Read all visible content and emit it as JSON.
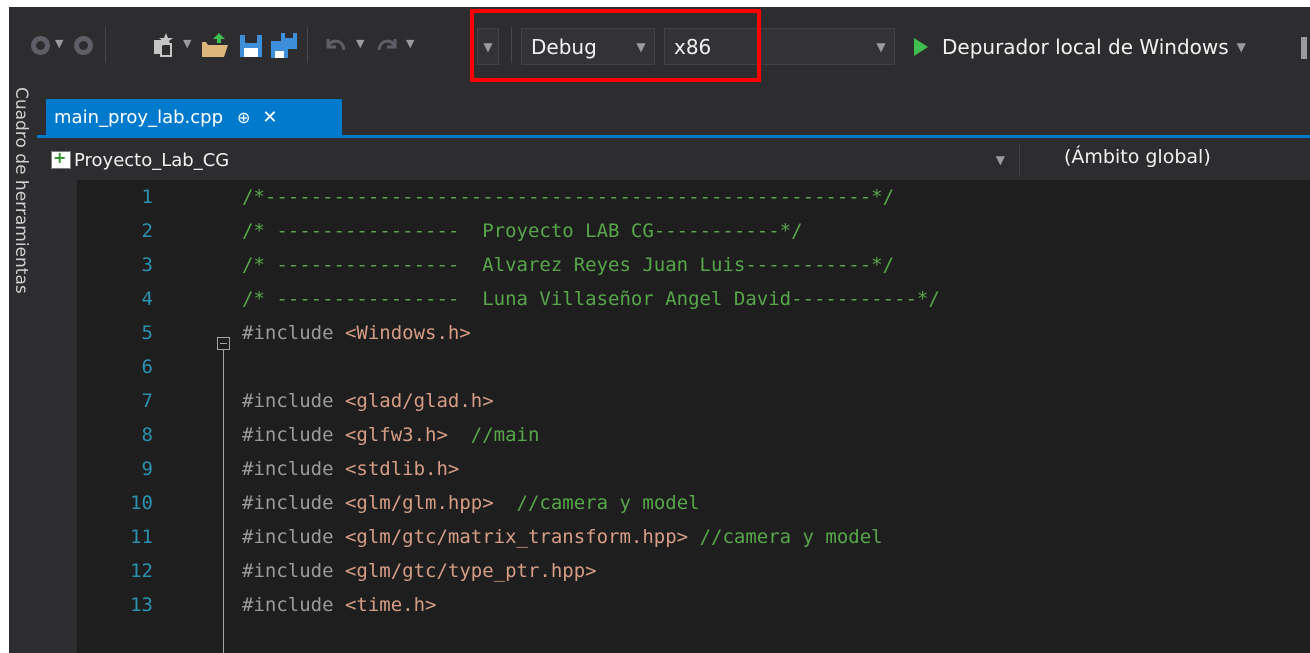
{
  "toolbar": {
    "configuration": "Debug",
    "platform": "x86",
    "run_label": "Depurador local de Windows",
    "icons": [
      "navigate-back-icon",
      "navigate-forward-icon",
      "new-project-icon",
      "open-folder-icon",
      "save-icon",
      "save-all-icon",
      "undo-icon",
      "redo-icon"
    ]
  },
  "side_panel": {
    "label": "Cuadro de herramientas"
  },
  "tabs": [
    {
      "label": "main_proy_lab.cpp",
      "pin": "⊕",
      "close": "✕",
      "active": true
    }
  ],
  "navbar": {
    "project": "Proyecto_Lab_CG",
    "scope": "(Ámbito global)"
  },
  "code": [
    {
      "n": "1",
      "parts": [
        {
          "t": "/*-----------------------------------------------------*/",
          "c": "comment"
        }
      ]
    },
    {
      "n": "2",
      "parts": [
        {
          "t": "/* ----------------  Proyecto LAB CG-----------*/",
          "c": "comment"
        }
      ]
    },
    {
      "n": "3",
      "parts": [
        {
          "t": "/* ----------------  Alvarez Reyes Juan Luis-----------*/",
          "c": "comment"
        }
      ]
    },
    {
      "n": "4",
      "parts": [
        {
          "t": "/* ----------------  Luna Villaseñor Angel David-----------*/",
          "c": "comment"
        }
      ]
    },
    {
      "n": "5",
      "parts": [
        {
          "t": "#include ",
          "c": "kw"
        },
        {
          "t": "<Windows.h>",
          "c": "inc"
        }
      ]
    },
    {
      "n": "6",
      "parts": []
    },
    {
      "n": "7",
      "parts": [
        {
          "t": "#include ",
          "c": "kw"
        },
        {
          "t": "<glad/glad.h>",
          "c": "inc"
        }
      ]
    },
    {
      "n": "8",
      "parts": [
        {
          "t": "#include ",
          "c": "kw"
        },
        {
          "t": "<glfw3.h>",
          "c": "inc"
        },
        {
          "t": "  //main",
          "c": "comment"
        }
      ]
    },
    {
      "n": "9",
      "parts": [
        {
          "t": "#include ",
          "c": "kw"
        },
        {
          "t": "<stdlib.h>",
          "c": "inc"
        }
      ]
    },
    {
      "n": "10",
      "parts": [
        {
          "t": "#include ",
          "c": "kw"
        },
        {
          "t": "<glm/glm.hpp>",
          "c": "inc"
        },
        {
          "t": "  //camera y model",
          "c": "comment"
        }
      ]
    },
    {
      "n": "11",
      "parts": [
        {
          "t": "#include ",
          "c": "kw"
        },
        {
          "t": "<glm/gtc/matrix_transform.hpp>",
          "c": "inc"
        },
        {
          "t": " //camera y model",
          "c": "comment"
        }
      ]
    },
    {
      "n": "12",
      "parts": [
        {
          "t": "#include ",
          "c": "kw"
        },
        {
          "t": "<glm/gtc/type_ptr.hpp>",
          "c": "inc"
        }
      ]
    },
    {
      "n": "13",
      "parts": [
        {
          "t": "#include ",
          "c": "kw"
        },
        {
          "t": "<time.h>",
          "c": "inc"
        }
      ]
    }
  ],
  "colors": {
    "accent": "#007acc",
    "highlight_box": "#ff0000",
    "comment": "#57a64a",
    "include_path": "#d69d85",
    "line_number": "#2b91af"
  }
}
